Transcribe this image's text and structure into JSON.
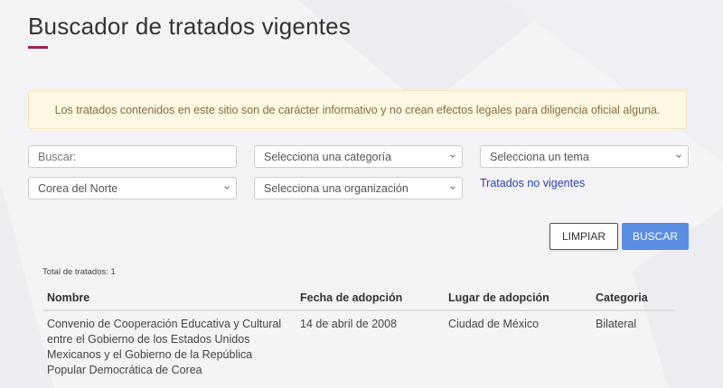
{
  "page": {
    "title": "Buscador de tratados vigentes",
    "notice": "Los tratados contenidos en este sitio son de carácter informativo y no crean efectos legales para diligencia oficial alguna."
  },
  "filters": {
    "search_placeholder": "Buscar:",
    "category_selected": "Selecciona una categoría",
    "topic_selected": "Selecciona un tema",
    "country_selected": "Corea del Norte",
    "organization_selected": "Selecciona una organización",
    "non_current_link": "Tratados no vigentes"
  },
  "actions": {
    "clear_label": "LIMPIAR",
    "search_label": "BUSCAR"
  },
  "results": {
    "total_label": "Total de tratados: 1",
    "columns": [
      "Nombre",
      "Fecha de adopción",
      "Lugar de adopción",
      "Categoria"
    ],
    "rows": [
      {
        "name": "Convenio de Cooperación Educativa y Cultural entre el Gobierno de los Estados Unidos Mexicanos y el Gobierno de la República Popular Democrática de Corea",
        "date": "14 de abril de 2008",
        "place": "Ciudad de México",
        "category": "Bilateral"
      }
    ]
  },
  "colors": {
    "accent": "#9d2449",
    "primary_button": "#5b8de3",
    "notice_bg": "#fcf8e3",
    "notice_text": "#8a6d3b",
    "link": "#2a3fa8"
  }
}
